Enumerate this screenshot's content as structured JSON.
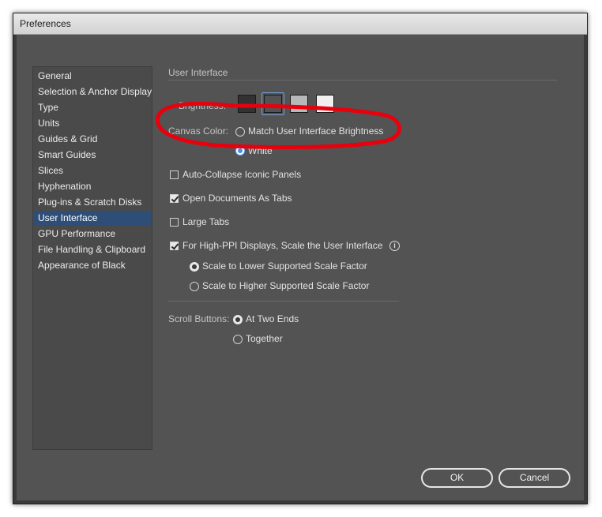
{
  "window": {
    "title": "Preferences"
  },
  "sidebar": {
    "items": [
      {
        "label": "General"
      },
      {
        "label": "Selection & Anchor Display"
      },
      {
        "label": "Type"
      },
      {
        "label": "Units"
      },
      {
        "label": "Guides & Grid"
      },
      {
        "label": "Smart Guides"
      },
      {
        "label": "Slices"
      },
      {
        "label": "Hyphenation"
      },
      {
        "label": "Plug-ins & Scratch Disks"
      },
      {
        "label": "User Interface",
        "selected": true
      },
      {
        "label": "GPU Performance"
      },
      {
        "label": "File Handling & Clipboard"
      },
      {
        "label": "Appearance of Black"
      }
    ]
  },
  "panel": {
    "section_title": "User Interface",
    "brightness": {
      "label": "Brightness:",
      "options": [
        {
          "name": "dark",
          "color": "#323232"
        },
        {
          "name": "medium-dark",
          "color": "#535353",
          "selected": true
        },
        {
          "name": "medium-light",
          "color": "#b8b8b8"
        },
        {
          "name": "light",
          "color": "#f0f0f0"
        }
      ]
    },
    "canvas_color": {
      "label": "Canvas Color:",
      "options": [
        {
          "label": "Match User Interface Brightness",
          "selected": false
        },
        {
          "label": "White",
          "selected": true
        }
      ]
    },
    "auto_collapse": {
      "label": "Auto-Collapse Iconic Panels",
      "checked": false
    },
    "open_docs_tabs": {
      "label": "Open Documents As Tabs",
      "checked": true
    },
    "large_tabs": {
      "label": "Large Tabs",
      "checked": false
    },
    "high_ppi": {
      "label": "For High-PPI Displays, Scale the User Interface",
      "checked": true,
      "info_icon": "info-icon",
      "options": [
        {
          "label": "Scale to Lower Supported Scale Factor",
          "selected": true
        },
        {
          "label": "Scale to Higher Supported Scale Factor",
          "selected": false
        }
      ]
    },
    "scroll_buttons": {
      "label": "Scroll Buttons:",
      "options": [
        {
          "label": "At Two Ends",
          "selected": true
        },
        {
          "label": "Together",
          "selected": false
        }
      ]
    }
  },
  "buttons": {
    "ok": "OK",
    "cancel": "Cancel"
  },
  "colors": {
    "panel_bg": "#535353",
    "selected_item": "#2e4e78",
    "annotation": "#e8000d"
  }
}
